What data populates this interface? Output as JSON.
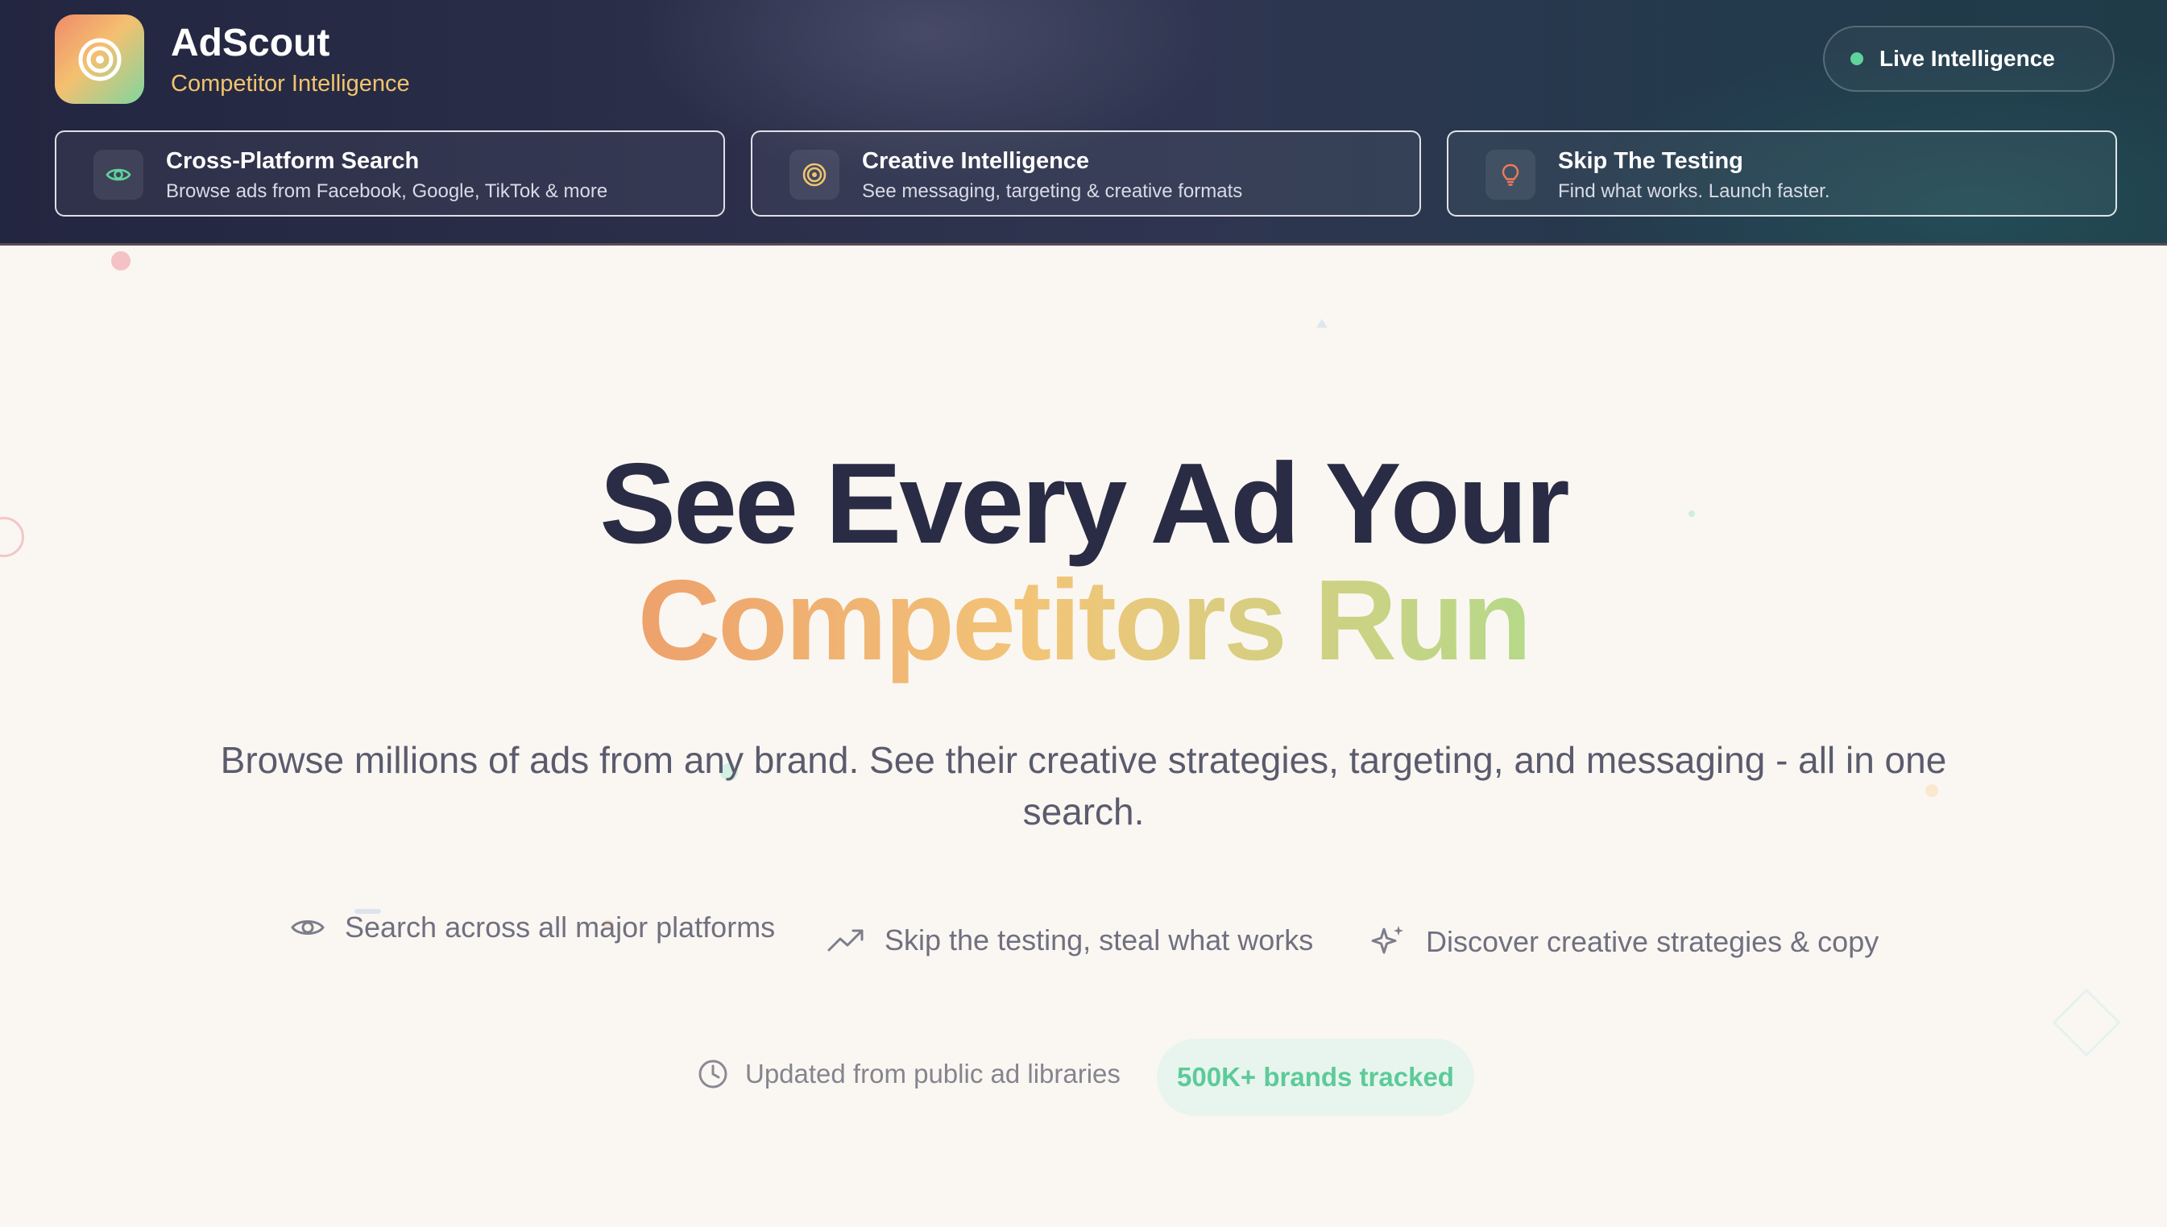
{
  "brand": {
    "name": "AdScout",
    "tagline": "Competitor Intelligence"
  },
  "live_badge": {
    "label": "Live Intelligence",
    "status_color": "#5fd39c"
  },
  "feature_cards": [
    {
      "icon": "eye-icon",
      "title": "Cross-Platform Search",
      "description": "Browse ads from Facebook, Google, TikTok & more"
    },
    {
      "icon": "target-icon",
      "title": "Creative Intelligence",
      "description": "See messaging, targeting & creative formats"
    },
    {
      "icon": "lightbulb-icon",
      "title": "Skip The Testing",
      "description": "Find what works. Launch faster."
    }
  ],
  "hero": {
    "headline_line1": "See Every Ad Your",
    "headline_line2": "Competitors Run",
    "subheadline": "Browse millions of ads from any brand. See their creative strategies, targeting, and messaging - all in one search."
  },
  "value_points": [
    {
      "icon": "eye-icon",
      "label": "Search across all major platforms"
    },
    {
      "icon": "trending-up-icon",
      "label": "Skip the testing, steal what works"
    },
    {
      "icon": "sparkles-icon",
      "label": "Discover creative strategies & copy"
    }
  ],
  "footer_info": {
    "updated_icon": "clock-icon",
    "updated_label": "Updated from public ad libraries",
    "brands_tracked": "500K+ brands tracked"
  },
  "colors": {
    "header_bg": "#232640",
    "accent_gold": "#f1c46c",
    "accent_green": "#5ccb98",
    "headline_dark": "#2a2c45",
    "page_bg": "#faf7f2"
  }
}
